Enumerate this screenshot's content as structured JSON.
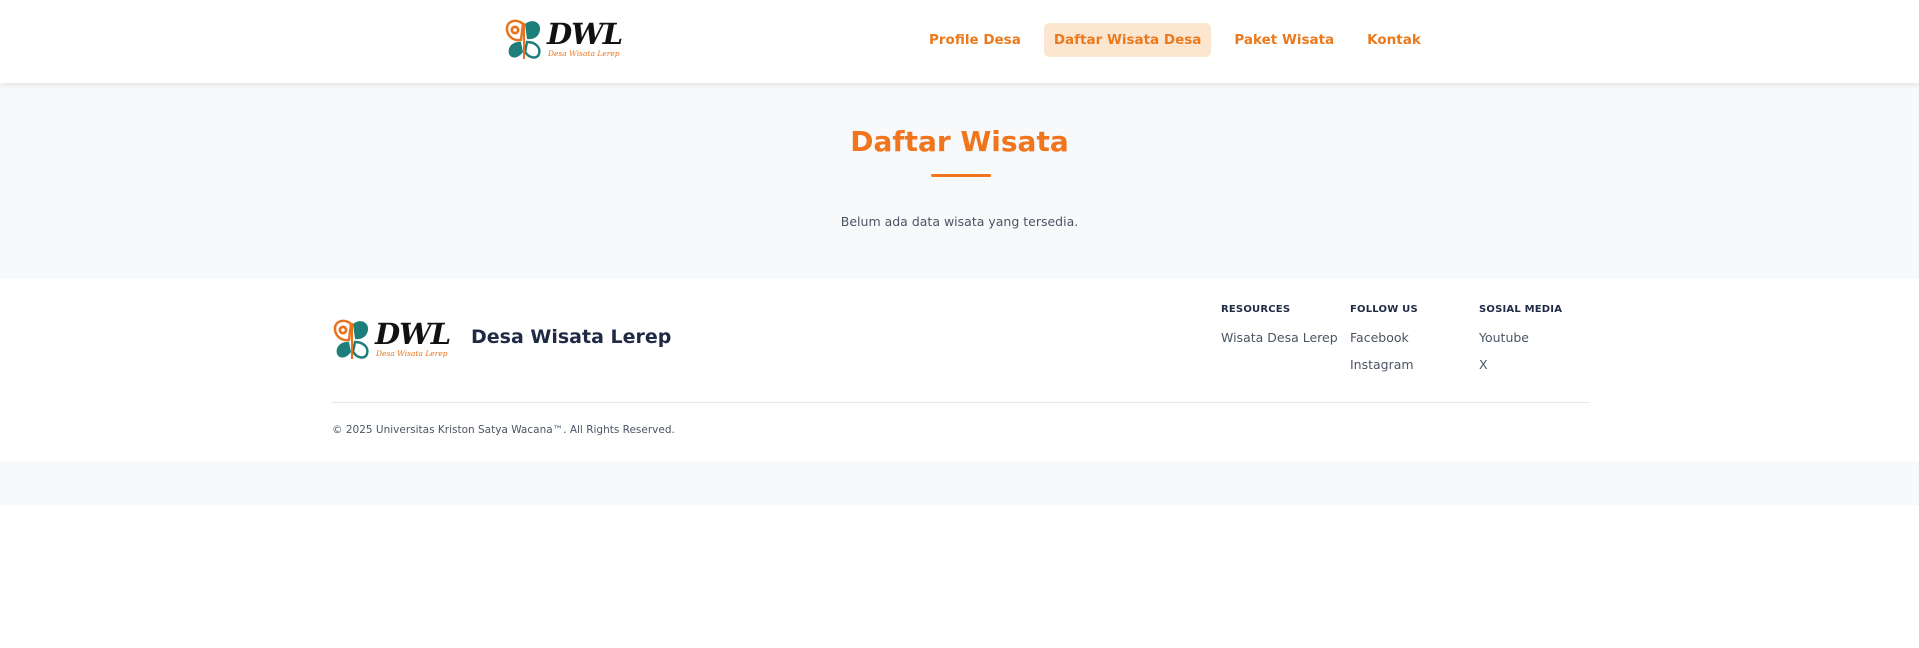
{
  "brand": {
    "logo_word": "DWL",
    "logo_sub": "Desa Wisata Lerep",
    "name": "Desa Wisata Lerep",
    "colors": {
      "orange": "#f0751c",
      "teal": "#1e7f7a",
      "dark": "#1f2a44"
    }
  },
  "nav": {
    "items": [
      {
        "label": "Profile Desa"
      },
      {
        "label": "Daftar Wisata Desa",
        "active": true
      },
      {
        "label": "Paket Wisata"
      },
      {
        "label": "Kontak"
      }
    ]
  },
  "main": {
    "title": "Daftar Wisata",
    "empty_message": "Belum ada data wisata yang tersedia."
  },
  "footer": {
    "columns": [
      {
        "heading": "RESOURCES",
        "links": [
          "Wisata Desa Lerep"
        ]
      },
      {
        "heading": "FOLLOW US",
        "links": [
          "Facebook",
          "Instagram"
        ]
      },
      {
        "heading": "SOSIAL MEDIA",
        "links": [
          "Youtube",
          "X"
        ]
      }
    ],
    "copyright": "© 2025 Universitas Kriston Satya Wacana™. All Rights Reserved."
  }
}
